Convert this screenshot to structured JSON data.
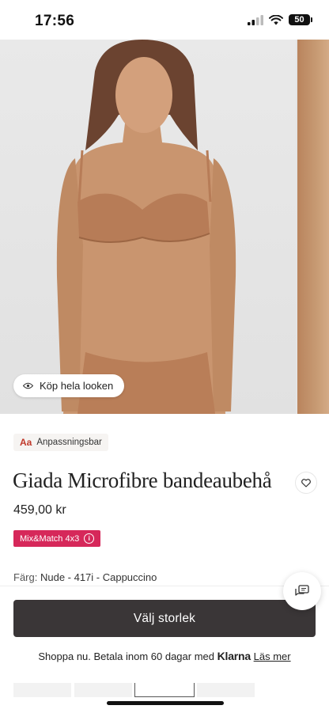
{
  "status_bar": {
    "time": "17:56",
    "battery": "50"
  },
  "hero": {
    "look_button_label": "Köp hela looken"
  },
  "product": {
    "badge_label": "Anpassningsbar",
    "badge_icon_text": "Aa",
    "title": "Giada Microfibre bandeaubehå",
    "price": "459,00 kr",
    "promo_label": "Mix&Match 4x3",
    "promo_info_icon": "i",
    "color_label": "Färg:",
    "color_value": "Nude - 417i - Cappuccino"
  },
  "actions": {
    "size_button_label": "Välj storlek"
  },
  "klarna": {
    "text": "Shoppa nu. Betala inom 60 dagar med",
    "brand": "Klarna",
    "link": "Läs mer"
  },
  "colors": {
    "primary_button": "#3a3637",
    "promo": "#d6285a",
    "accent": "#c0392b"
  },
  "icons": [
    "signal-icon",
    "wifi-icon",
    "battery-icon",
    "eye-icon",
    "heart-icon",
    "info-icon",
    "chat-icon"
  ]
}
